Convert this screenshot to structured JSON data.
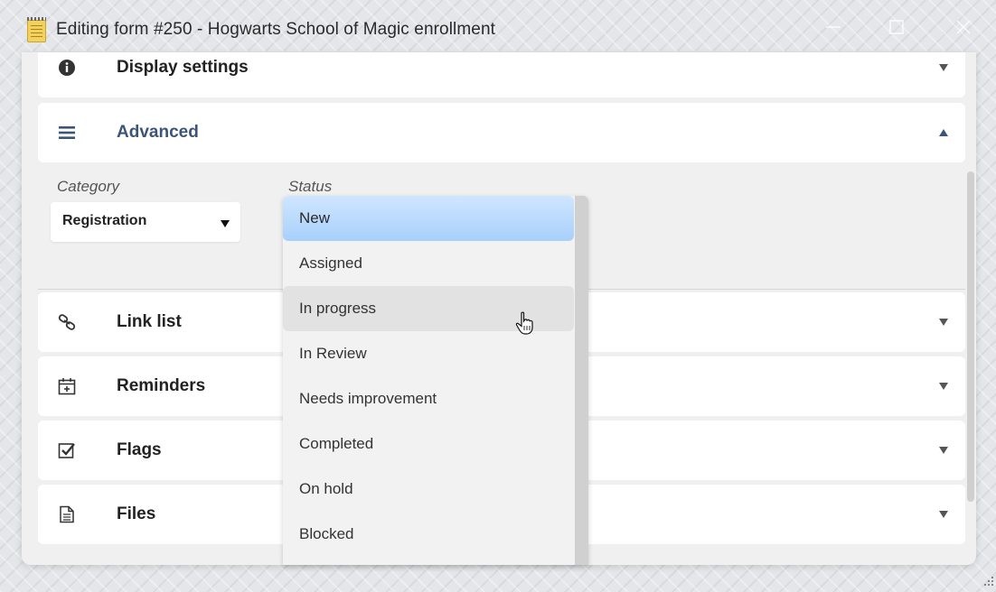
{
  "window": {
    "title": "Editing form #250 - Hogwarts School of Magic enrollment",
    "icon": "notepad-icon"
  },
  "sections": {
    "display_settings": {
      "label": "Display settings",
      "icon": "info-circle-icon"
    },
    "advanced": {
      "label": "Advanced",
      "icon": "hamburger-menu-icon",
      "accent": "#3c5478"
    },
    "link_list": {
      "label": "Link list",
      "icon": "link-icon"
    },
    "reminders": {
      "label": "Reminders",
      "icon": "calendar-add-icon"
    },
    "flags": {
      "label": "Flags",
      "icon": "checkbox-checked-icon"
    },
    "files": {
      "label": "Files",
      "icon": "document-icon"
    }
  },
  "advanced": {
    "category_label": "Category",
    "category_value": "Registration",
    "status_label": "Status"
  },
  "status_dropdown": {
    "options": [
      "New",
      "Assigned",
      "In progress",
      "In Review",
      "Needs improvement",
      "Completed",
      "On hold",
      "Blocked"
    ],
    "selected": "New",
    "hovered": "In progress",
    "selected_color": "#b9dbfd"
  }
}
